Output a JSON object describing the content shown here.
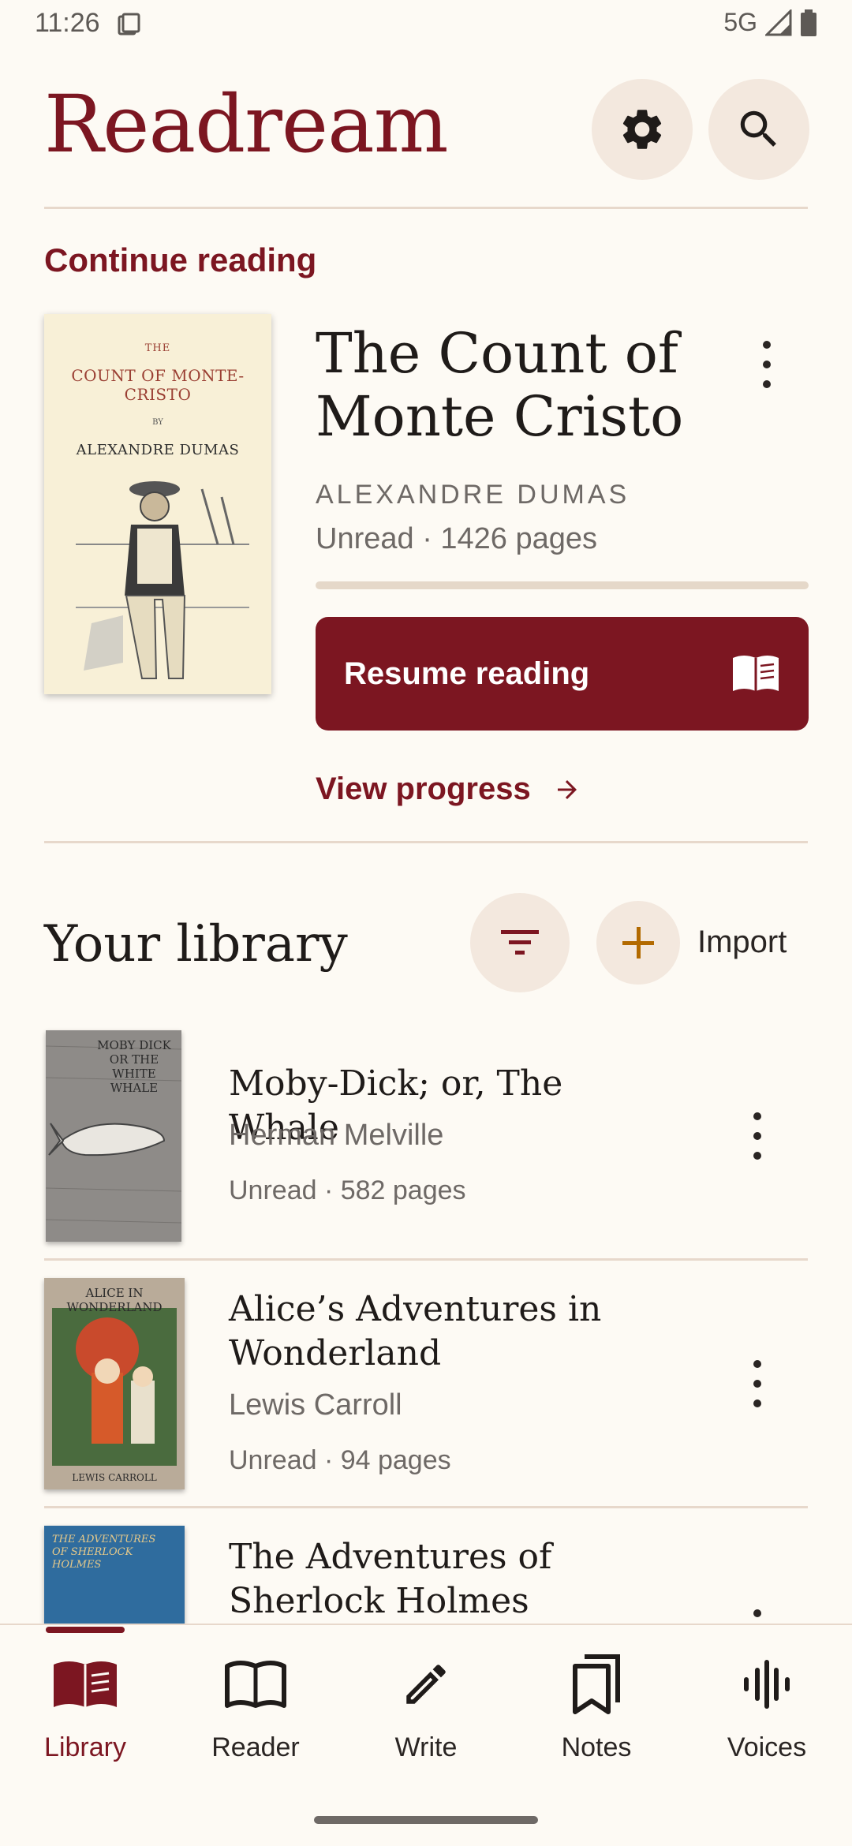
{
  "status_bar": {
    "time": "11:26",
    "network": "5G"
  },
  "app": {
    "title": "Readream"
  },
  "header": {
    "settings_icon": "gear-icon",
    "search_icon": "search-icon"
  },
  "continue_reading": {
    "section_label": "Continue reading",
    "cover": {
      "title_small": "THE",
      "title": "COUNT OF MONTE-CRISTO",
      "by": "BY",
      "author": "ALEXANDRE DUMAS"
    },
    "title": "The Count of Monte Cristo",
    "author": "ALEXANDRE DUMAS",
    "meta": "Unread · 1426 pages",
    "progress": 0,
    "resume_label": "Resume reading",
    "view_progress_label": "View progress"
  },
  "library": {
    "title": "Your library",
    "import_label": "Import",
    "books": [
      {
        "title": "Moby-Dick; or, The Whale",
        "author": "Herman Melville",
        "meta": "Unread · 582 pages",
        "cover_text": "MOBY DICK OR THE WHITE WHALE"
      },
      {
        "title": "Alice’s Adventures in Wonderland",
        "author": "Lewis Carroll",
        "meta": "Unread · 94 pages",
        "cover_text": "ALICE IN WONDERLAND",
        "cover_author": "LEWIS CARROLL"
      },
      {
        "title": "The Adventures of Sherlock Holmes",
        "cover_text": "THE ADVENTURES OF SHERLOCK HOLMES"
      }
    ]
  },
  "nav": {
    "items": [
      {
        "label": "Library",
        "icon": "book-open-icon",
        "active": true
      },
      {
        "label": "Reader",
        "icon": "book-outline-icon"
      },
      {
        "label": "Write",
        "icon": "pencil-icon"
      },
      {
        "label": "Notes",
        "icon": "notes-icon"
      },
      {
        "label": "Voices",
        "icon": "waveform-icon"
      }
    ]
  },
  "colors": {
    "accent": "#7c1621",
    "background": "#fdfaf4",
    "chip": "#f3e8de"
  }
}
